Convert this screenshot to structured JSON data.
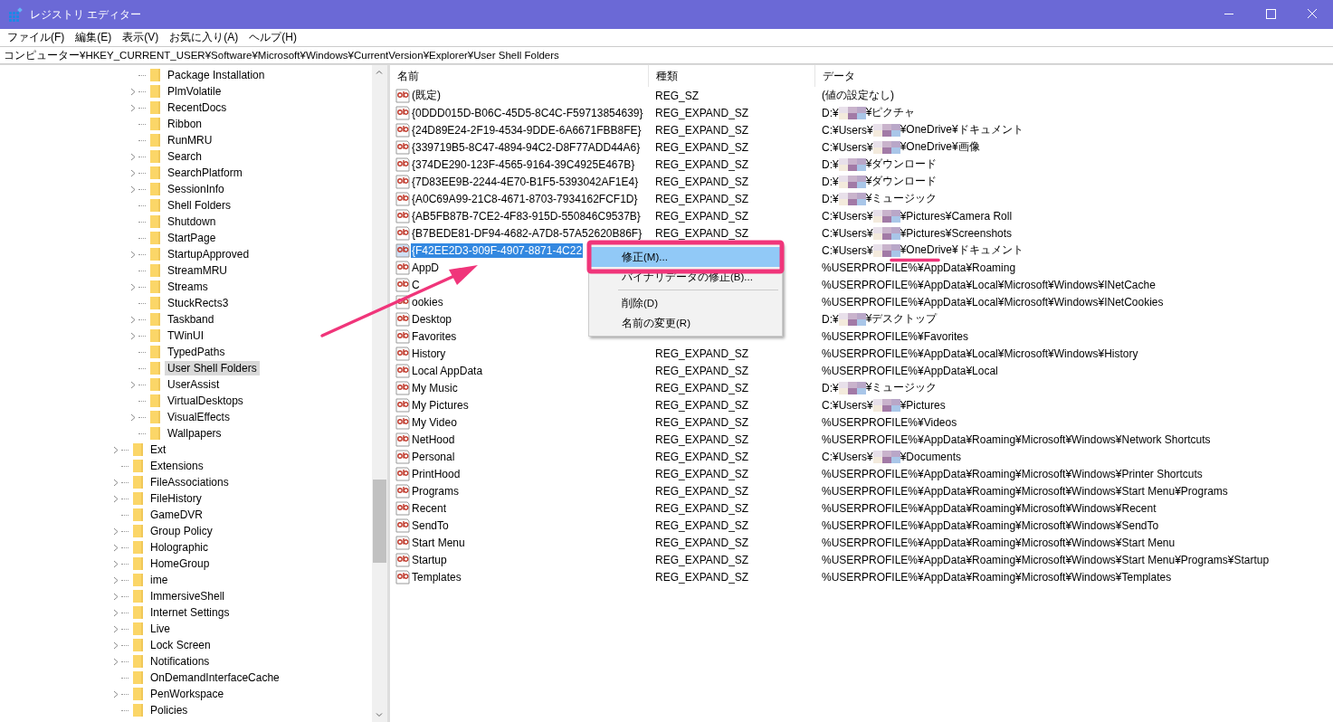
{
  "window": {
    "title": "レジストリ エディター"
  },
  "menu": [
    "ファイル(F)",
    "編集(E)",
    "表示(V)",
    "お気に入り(A)",
    "ヘルプ(H)"
  ],
  "address": "コンピューター¥HKEY_CURRENT_USER¥Software¥Microsoft¥Windows¥CurrentVersion¥Explorer¥User Shell Folders",
  "tree": {
    "continued_children": [
      {
        "label": "Package Installation",
        "expandable": false,
        "selected": false
      },
      {
        "label": "PlmVolatile",
        "expandable": true,
        "selected": false
      },
      {
        "label": "RecentDocs",
        "expandable": true,
        "selected": false
      },
      {
        "label": "Ribbon",
        "expandable": false,
        "selected": false
      },
      {
        "label": "RunMRU",
        "expandable": false,
        "selected": false
      },
      {
        "label": "Search",
        "expandable": true,
        "selected": false
      },
      {
        "label": "SearchPlatform",
        "expandable": true,
        "selected": false
      },
      {
        "label": "SessionInfo",
        "expandable": true,
        "selected": false
      },
      {
        "label": "Shell Folders",
        "expandable": false,
        "selected": false
      },
      {
        "label": "Shutdown",
        "expandable": false,
        "selected": false
      },
      {
        "label": "StartPage",
        "expandable": false,
        "selected": false
      },
      {
        "label": "StartupApproved",
        "expandable": true,
        "selected": false
      },
      {
        "label": "StreamMRU",
        "expandable": false,
        "selected": false
      },
      {
        "label": "Streams",
        "expandable": true,
        "selected": false
      },
      {
        "label": "StuckRects3",
        "expandable": false,
        "selected": false
      },
      {
        "label": "Taskband",
        "expandable": true,
        "selected": false
      },
      {
        "label": "TWinUI",
        "expandable": true,
        "selected": false
      },
      {
        "label": "TypedPaths",
        "expandable": false,
        "selected": false
      },
      {
        "label": "User Shell Folders",
        "expandable": false,
        "selected": true
      },
      {
        "label": "UserAssist",
        "expandable": true,
        "selected": false
      },
      {
        "label": "VirtualDesktops",
        "expandable": false,
        "selected": false
      },
      {
        "label": "VisualEffects",
        "expandable": true,
        "selected": false
      },
      {
        "label": "Wallpapers",
        "expandable": false,
        "selected": false
      }
    ],
    "items": [
      {
        "label": "Ext",
        "expandable": true,
        "selected": false
      },
      {
        "label": "Extensions",
        "expandable": false,
        "selected": false
      },
      {
        "label": "FileAssociations",
        "expandable": true,
        "selected": false
      },
      {
        "label": "FileHistory",
        "expandable": true,
        "selected": false
      },
      {
        "label": "GameDVR",
        "expandable": false,
        "selected": false
      },
      {
        "label": "Group Policy",
        "expandable": true,
        "selected": false
      },
      {
        "label": "Holographic",
        "expandable": true,
        "selected": false
      },
      {
        "label": "HomeGroup",
        "expandable": true,
        "selected": false
      },
      {
        "label": "ime",
        "expandable": true,
        "selected": false
      },
      {
        "label": "ImmersiveShell",
        "expandable": true,
        "selected": false
      },
      {
        "label": "Internet Settings",
        "expandable": true,
        "selected": false
      },
      {
        "label": "Live",
        "expandable": true,
        "selected": false
      },
      {
        "label": "Lock Screen",
        "expandable": true,
        "selected": false
      },
      {
        "label": "Notifications",
        "expandable": true,
        "selected": false
      },
      {
        "label": "OnDemandInterfaceCache",
        "expandable": false,
        "selected": false
      },
      {
        "label": "PenWorkspace",
        "expandable": true,
        "selected": false
      },
      {
        "label": "Policies",
        "expandable": false,
        "selected": false
      }
    ]
  },
  "table": {
    "columns": [
      "名前",
      "種類",
      "データ"
    ],
    "rows": [
      {
        "name": "(既定)",
        "type": "REG_SZ",
        "data": "(値の設定なし)",
        "selected": false
      },
      {
        "name": "{0DDD015D-B06C-45D5-8C4C-F59713854639}",
        "type": "REG_EXPAND_SZ",
        "data": "D:¥",
        "data_after": "¥ピクチャ",
        "selected": false
      },
      {
        "name": "{24D89E24-2F19-4534-9DDE-6A6671FBB8FE}",
        "type": "REG_EXPAND_SZ",
        "data": "C:¥Users¥",
        "data_after": "¥OneDrive¥ドキュメント",
        "selected": false
      },
      {
        "name": "{339719B5-8C47-4894-94C2-D8F77ADD44A6}",
        "type": "REG_EXPAND_SZ",
        "data": "C:¥Users¥",
        "data_after": "¥OneDrive¥画像",
        "selected": false
      },
      {
        "name": "{374DE290-123F-4565-9164-39C4925E467B}",
        "type": "REG_EXPAND_SZ",
        "data": "D:¥",
        "data_after": "¥ダウンロード",
        "selected": false
      },
      {
        "name": "{7D83EE9B-2244-4E70-B1F5-5393042AF1E4}",
        "type": "REG_EXPAND_SZ",
        "data": "D:¥",
        "data_after": "¥ダウンロード",
        "selected": false
      },
      {
        "name": "{A0C69A99-21C8-4671-8703-7934162FCF1D}",
        "type": "REG_EXPAND_SZ",
        "data": "D:¥",
        "data_after": "¥ミュージック",
        "selected": false
      },
      {
        "name": "{AB5FB87B-7CE2-4F83-915D-550846C9537B}",
        "type": "REG_EXPAND_SZ",
        "data": "C:¥Users¥",
        "data_after": "¥Pictures¥Camera Roll",
        "selected": false
      },
      {
        "name": "{B7BEDE81-DF94-4682-A7D8-57A52620B86F}",
        "type": "REG_EXPAND_SZ",
        "data": "C:¥Users¥",
        "data_after": "¥Pictures¥Screenshots",
        "selected": false
      },
      {
        "name": "{F42EE2D3-909F-4907-8871-4C22",
        "data": "C:¥Users¥",
        "data_after": "¥OneDrive¥ドキュメント",
        "selected": true
      },
      {
        "name": "AppD",
        "data": "%USERPROFILE%¥AppData¥Roaming",
        "selected": false
      },
      {
        "name": "C",
        "data": "%USERPROFILE%¥AppData¥Local¥Microsoft¥Windows¥INetCache",
        "selected": false
      },
      {
        "name": "ookies",
        "data": "%USERPROFILE%¥AppData¥Local¥Microsoft¥Windows¥INetCookies",
        "selected": false
      },
      {
        "name": "Desktop",
        "data": "D:¥",
        "data_after": "¥デスクトップ",
        "selected": false
      },
      {
        "name": "Favorites",
        "data": "%USERPROFILE%¥Favorites",
        "selected": false
      },
      {
        "name": "History",
        "type": "REG_EXPAND_SZ",
        "data": "%USERPROFILE%¥AppData¥Local¥Microsoft¥Windows¥History",
        "selected": false
      },
      {
        "name": "Local AppData",
        "type": "REG_EXPAND_SZ",
        "data": "%USERPROFILE%¥AppData¥Local",
        "selected": false
      },
      {
        "name": "My Music",
        "type": "REG_EXPAND_SZ",
        "data": "D:¥",
        "data_after": "¥ミュージック",
        "selected": false
      },
      {
        "name": "My Pictures",
        "type": "REG_EXPAND_SZ",
        "data": "C:¥Users¥",
        "data_after": "¥Pictures",
        "selected": false
      },
      {
        "name": "My Video",
        "type": "REG_EXPAND_SZ",
        "data": "%USERPROFILE%¥Videos",
        "selected": false
      },
      {
        "name": "NetHood",
        "type": "REG_EXPAND_SZ",
        "data": "%USERPROFILE%¥AppData¥Roaming¥Microsoft¥Windows¥Network Shortcuts",
        "selected": false
      },
      {
        "name": "Personal",
        "type": "REG_EXPAND_SZ",
        "data": "C:¥Users¥",
        "data_after": "¥Documents",
        "selected": false
      },
      {
        "name": "PrintHood",
        "type": "REG_EXPAND_SZ",
        "data": "%USERPROFILE%¥AppData¥Roaming¥Microsoft¥Windows¥Printer Shortcuts",
        "selected": false
      },
      {
        "name": "Programs",
        "type": "REG_EXPAND_SZ",
        "data": "%USERPROFILE%¥AppData¥Roaming¥Microsoft¥Windows¥Start Menu¥Programs",
        "selected": false
      },
      {
        "name": "Recent",
        "type": "REG_EXPAND_SZ",
        "data": "%USERPROFILE%¥AppData¥Roaming¥Microsoft¥Windows¥Recent",
        "selected": false
      },
      {
        "name": "SendTo",
        "type": "REG_EXPAND_SZ",
        "data": "%USERPROFILE%¥AppData¥Roaming¥Microsoft¥Windows¥SendTo",
        "selected": false
      },
      {
        "name": "Start Menu",
        "type": "REG_EXPAND_SZ",
        "data": "%USERPROFILE%¥AppData¥Roaming¥Microsoft¥Windows¥Start Menu",
        "selected": false
      },
      {
        "name": "Startup",
        "type": "REG_EXPAND_SZ",
        "data": "%USERPROFILE%¥AppData¥Roaming¥Microsoft¥Windows¥Start Menu¥Programs¥Startup",
        "selected": false
      },
      {
        "name": "Templates",
        "type": "REG_EXPAND_SZ",
        "data": "%USERPROFILE%¥AppData¥Roaming¥Microsoft¥Windows¥Templates",
        "selected": false
      }
    ]
  },
  "context_menu": {
    "items": [
      {
        "kind": "item",
        "label": "修正(M)...",
        "selected": true
      },
      {
        "kind": "item",
        "label": "バイナリデータの修正(B)...",
        "selected": false
      },
      {
        "kind": "separator"
      },
      {
        "kind": "item",
        "label": "削除(D)",
        "selected": false
      },
      {
        "kind": "item",
        "label": "名前の変更(R)",
        "selected": false
      }
    ]
  }
}
